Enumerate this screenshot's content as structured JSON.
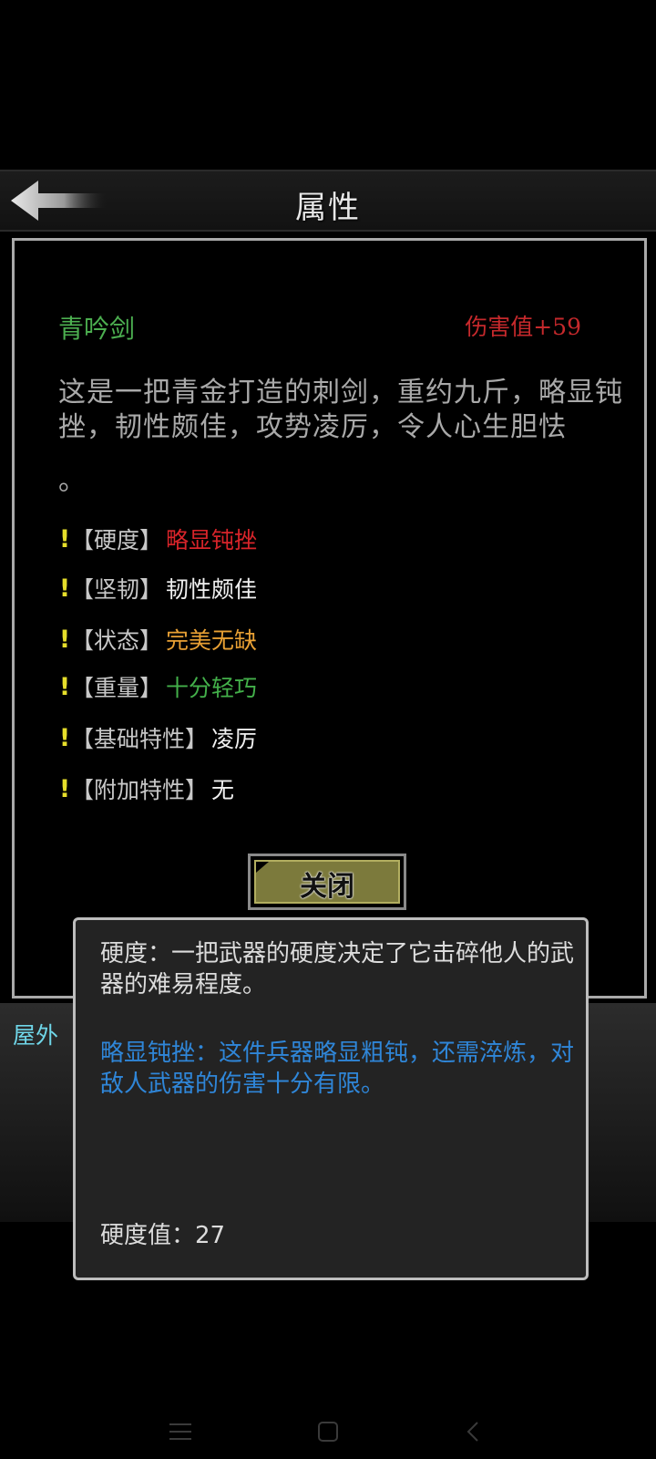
{
  "header": {
    "title": "属性"
  },
  "item": {
    "name": "青吟剑",
    "damage": "伤害值+59",
    "description": "这是一把青金打造的刺剑，重约九斤，略显钝挫，韧性颇佳，攻势凌厉，令人心生胆怯",
    "description_end": "。"
  },
  "attributes": [
    {
      "bang": "!",
      "label": "【硬度】",
      "value": "略显钝挫",
      "color": "#d8242a"
    },
    {
      "bang": "!",
      "label": "【坚韧】",
      "value": "韧性颇佳",
      "color": "#f0f0f0"
    },
    {
      "bang": "!",
      "label": "【状态】",
      "value": "完美无缺",
      "color": "#e8a034"
    },
    {
      "bang": "!",
      "label": "【重量】",
      "value": "十分轻巧",
      "color": "#43b04a"
    },
    {
      "bang": "!",
      "label": "【基础特性】",
      "value": "凌厉",
      "color": "#f0f0f0"
    },
    {
      "bang": "!",
      "label": "【附加特性】",
      "value": "无",
      "color": "#f0f0f0"
    }
  ],
  "close_button": {
    "label": "关闭"
  },
  "tooltip": {
    "title": "硬度：一把武器的硬度决定了它击碎他人的武器的难易程度。",
    "detail": "略显钝挫：这件兵器略显粗钝，还需淬炼，对敌人武器的伤害十分有限。",
    "value_line": "硬度值：27"
  },
  "scene": {
    "label": "屋外"
  },
  "icons": {
    "back": "back-arrow-icon",
    "nav_menu": "menu-icon",
    "nav_home": "home-icon",
    "nav_back": "chevron-left-icon"
  }
}
